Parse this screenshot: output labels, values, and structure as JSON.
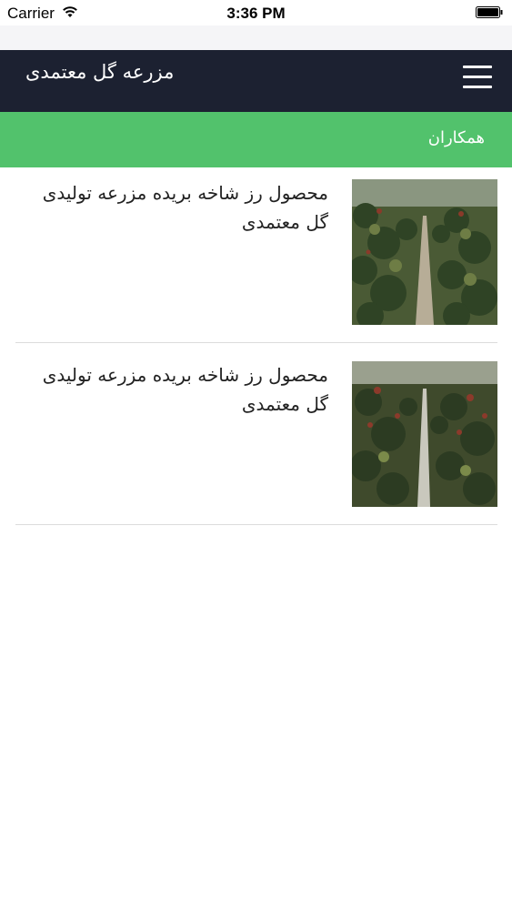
{
  "status_bar": {
    "carrier": "Carrier",
    "time": "3:36 PM"
  },
  "navbar": {
    "title": "مزرعه گل معتمدی",
    "menu_icon": "hamburger-menu-icon"
  },
  "subheader": {
    "label": "همکاران"
  },
  "items": [
    {
      "title": "محصول رز شاخه بریده مزرعه تولیدی گل معتمدی",
      "image": "greenhouse-rose-rows"
    },
    {
      "title": "محصول رز شاخه بریده مزرعه تولیدی گل معتمدی",
      "image": "greenhouse-rose-rows"
    }
  ]
}
